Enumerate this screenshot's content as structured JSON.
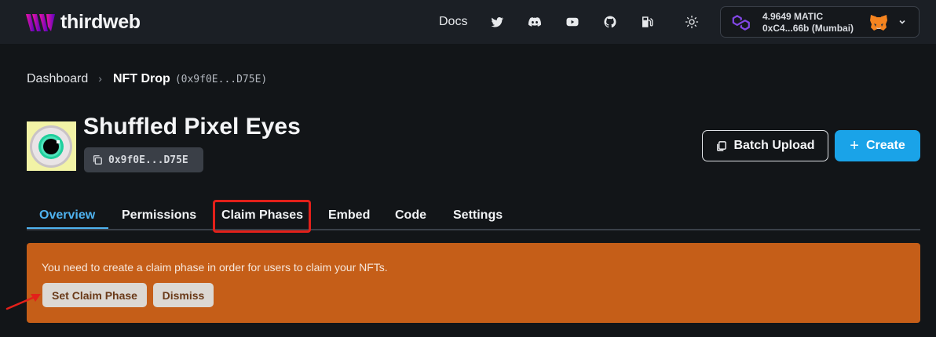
{
  "brand": {
    "name": "thirdweb"
  },
  "nav": {
    "docs": "Docs",
    "icons": [
      "twitter-icon",
      "discord-icon",
      "youtube-icon",
      "github-icon",
      "gas-pump-icon",
      "sun-icon"
    ]
  },
  "wallet": {
    "balance": "4.9649 MATIC",
    "address": "0xC4...66b (Mumbai)"
  },
  "breadcrumb": {
    "root": "Dashboard",
    "separator": "›",
    "current": "NFT Drop",
    "address": "(0x9f0E...D75E)"
  },
  "contract": {
    "title": "Shuffled Pixel Eyes",
    "address": "0x9f0E...D75E"
  },
  "actions": {
    "batch_upload": "Batch Upload",
    "create": "Create"
  },
  "tabs": [
    {
      "label": "Overview",
      "active": true
    },
    {
      "label": "Permissions"
    },
    {
      "label": "Claim Phases"
    },
    {
      "label": "Embed"
    },
    {
      "label": "Code"
    },
    {
      "label": "Settings"
    }
  ],
  "alert": {
    "message": "You need to create a claim phase in order for users to claim your NFTs.",
    "set_button": "Set Claim Phase",
    "dismiss_button": "Dismiss"
  },
  "colors": {
    "accent": "#1aa3e8",
    "alert": "#c55e18",
    "highlight": "#e3201a",
    "logo": "#c83fe6"
  }
}
